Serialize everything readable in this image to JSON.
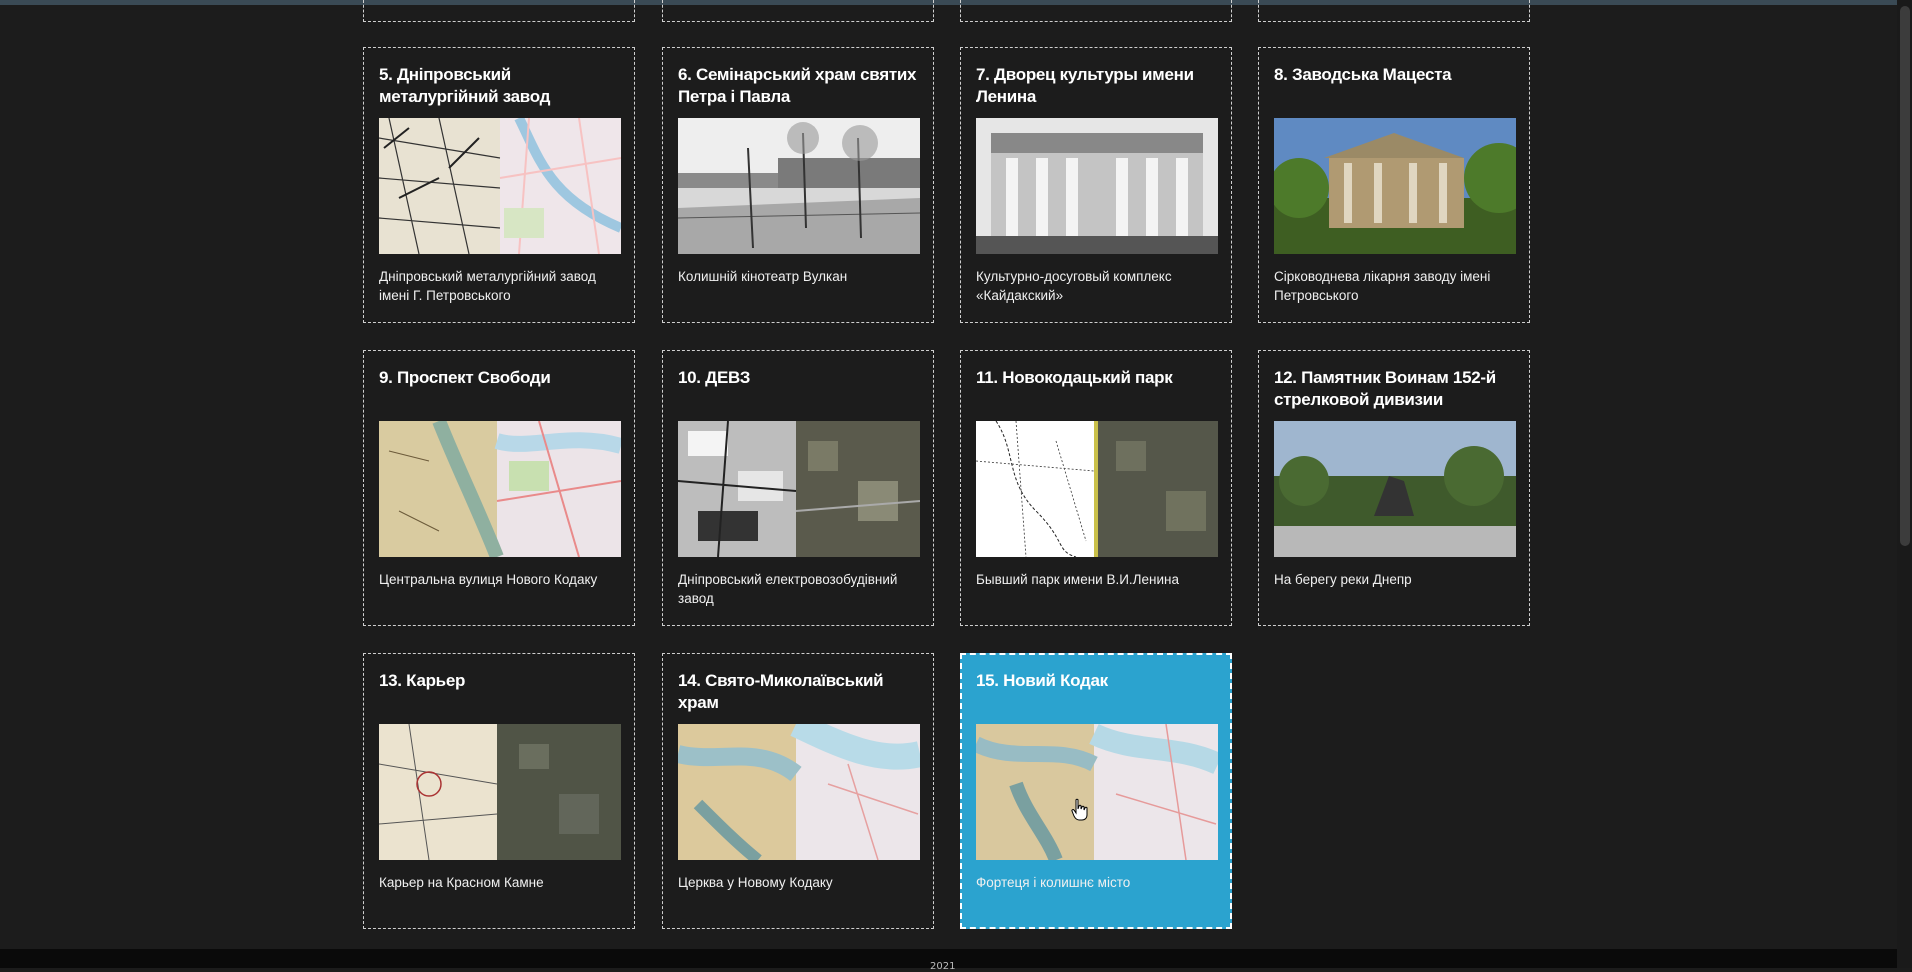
{
  "cards_top_row_partial": 4,
  "cards": [
    {
      "title": "5. Дніпровський металургійний завод",
      "caption": "Дніпровський металургійний завод імені Г. Петровського",
      "image": "map-overlay-image"
    },
    {
      "title": "6. Семінарський храм святих Петра і Павла",
      "caption": "Колишній кінотеатр Вулкан",
      "image": "old-photo-street"
    },
    {
      "title": "7. Дворец культуры имени Ленина",
      "caption": "Культурно-досуговый комплекс «Кайдакский»",
      "image": "old-photo-palace"
    },
    {
      "title": "8. Заводська Мацеста",
      "caption": "Сірководнева лікарня заводу імені Петровського",
      "image": "photo-ruined-building"
    },
    {
      "title": "9. Проспект Свободи",
      "caption": "Центральна вулиця Нового Кодаку",
      "image": "map-overlay-image"
    },
    {
      "title": "10. ДЕВЗ",
      "caption": "Дніпровський електровозобудівний завод",
      "image": "satellite-overlay-image"
    },
    {
      "title": "11. Новокодацький парк",
      "caption": "Бывший парк имени В.И.Ленина",
      "image": "sketch-satellite-image"
    },
    {
      "title": "12. Памятник Воинам 152-й стрелковой дивизии",
      "caption": "На берегу реки Днепр",
      "image": "photo-monument"
    },
    {
      "title": "13. Карьер",
      "caption": "Карьер на Красном Камне",
      "image": "map-satellite-image"
    },
    {
      "title": "14. Свято-Миколаївський храм",
      "caption": "Церква у Новому Кодаку",
      "image": "map-overlay-image"
    },
    {
      "title": "15. Новий Кодак",
      "caption": "Фортеця і колишнє місто",
      "image": "map-overlay-image",
      "active": true
    }
  ],
  "footer": {
    "text": "2021"
  },
  "colors": {
    "background": "#1c1c1c",
    "active_card": "#2ba3cf",
    "border": "#cfcfcf"
  }
}
